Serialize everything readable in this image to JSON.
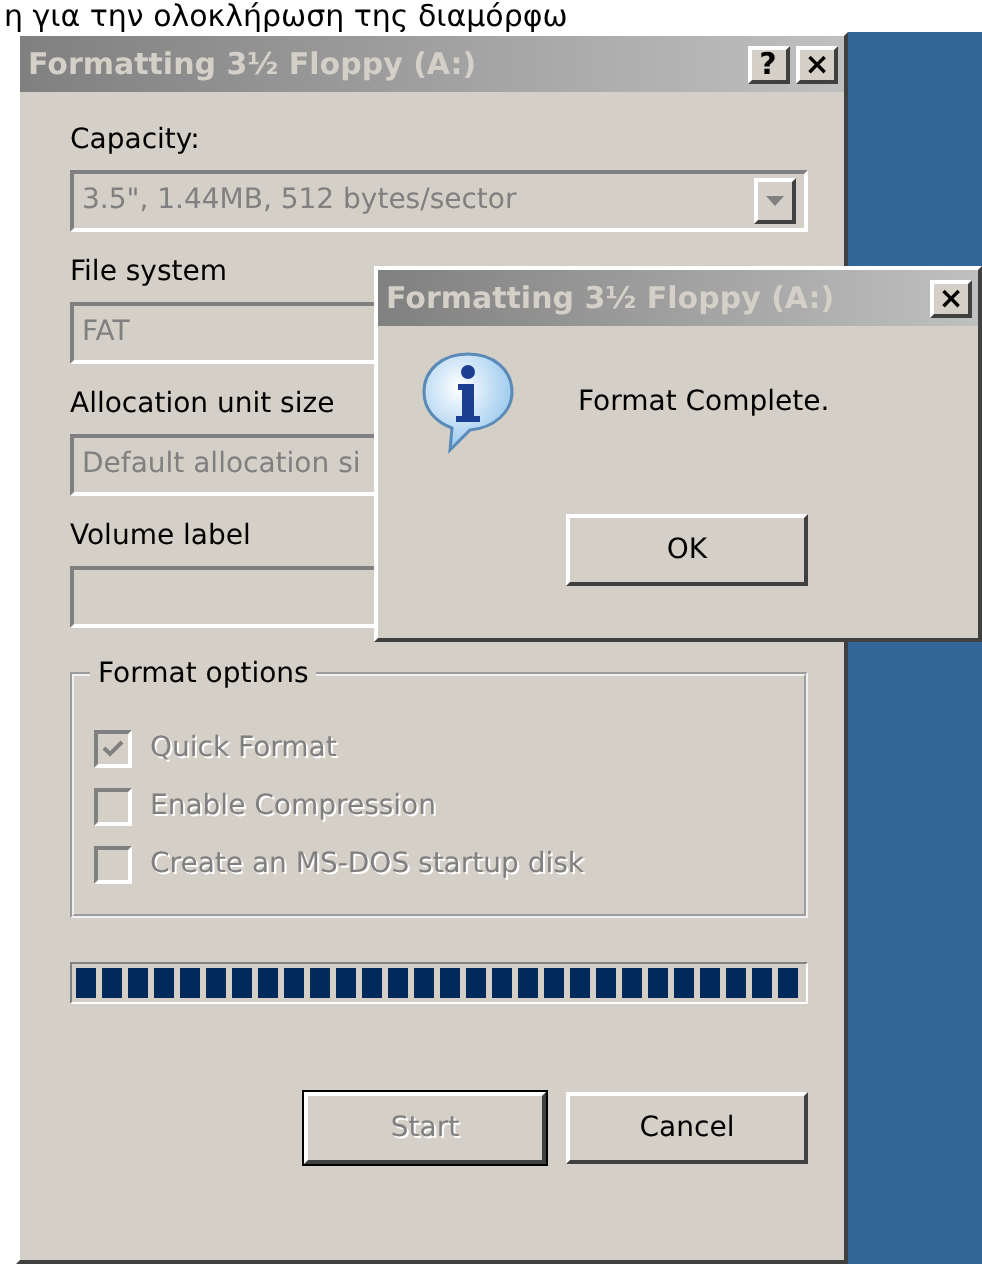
{
  "page_caption": "η για την ολοκλήρωση της διαμόρφω",
  "dialog": {
    "title": "Formatting 3½ Floppy (A:)",
    "title_buttons": [
      "?",
      "×"
    ],
    "fields": [
      {
        "label": "Capacity:",
        "value": "3.5\",  1.44MB, 512 bytes/sector",
        "kind": "dropdown",
        "disabled": true
      },
      {
        "label": "File system",
        "value": "FAT",
        "kind": "box",
        "disabled": true
      },
      {
        "label": "Allocation unit size",
        "value": "Default allocation si",
        "kind": "box",
        "disabled": true
      },
      {
        "label": "Volume label",
        "kind": "box",
        "disabled": true
      }
    ],
    "format_options": {
      "title": "Format options",
      "options": [
        {
          "label": "Quick Format",
          "checked": true,
          "disabled": true
        },
        {
          "label": "Enable Compression",
          "checked": false,
          "disabled": true
        },
        {
          "label": "Create an MS-DOS startup disk",
          "checked": false,
          "disabled": true
        }
      ]
    },
    "progress": {
      "level": 1
    },
    "buttons": [
      {
        "label": "Start",
        "disabled": true,
        "default": true
      },
      {
        "label": "Cancel",
        "disabled": false,
        "default": false
      }
    ]
  },
  "message_box": {
    "title": "Formatting 3½ Floppy (A:)",
    "close": "×",
    "message": "Format Complete.",
    "button": "OK"
  }
}
